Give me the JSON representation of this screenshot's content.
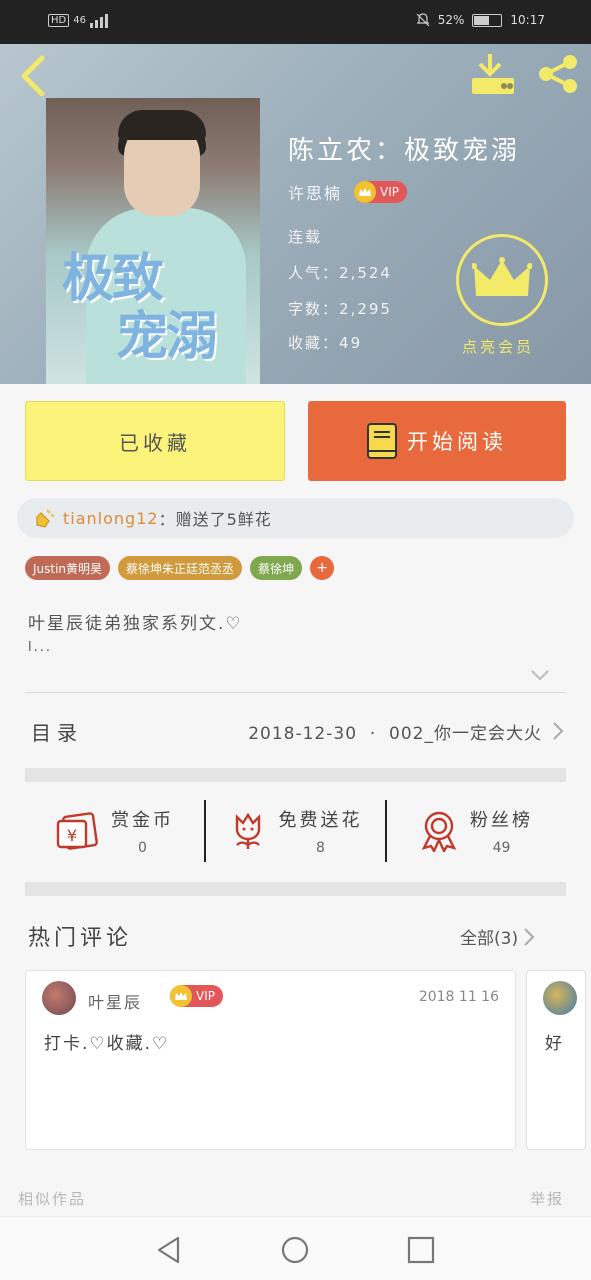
{
  "status_bar": {
    "network": "HD",
    "signal_type": "46",
    "battery_percent": "52%",
    "time": "10:17"
  },
  "book": {
    "title": "陈立农：极致宠溺",
    "author": "许思楠",
    "author_badge": "VIP",
    "status": "连载",
    "popularity_label": "人气",
    "popularity": "2,524",
    "word_count_label": "字数",
    "word_count": "2,295",
    "favorites_label": "收藏",
    "favorites": "49",
    "member_label": "点亮会员",
    "cover_text_line1": "极致",
    "cover_text_line2": "宠溺"
  },
  "actions": {
    "favorited_label": "已收藏",
    "read_label": "开始阅读"
  },
  "gift_notice": {
    "user": "tianlong12",
    "message": "：赠送了5鲜花"
  },
  "tags": [
    {
      "label": "Justin黄明昊",
      "color": "#c06a55"
    },
    {
      "label": "蔡徐坤朱正廷范丞丞",
      "color": "#d19a3c"
    },
    {
      "label": "蔡徐坤",
      "color": "#7fa84f"
    }
  ],
  "tag_more": "+",
  "description": {
    "line1": "叶星辰徒弟独家系列文.♡",
    "line2": "l..."
  },
  "catalog": {
    "label": "目录",
    "latest_date": "2018-12-30",
    "separator": "·",
    "latest_chapter": "002_你一定会大火"
  },
  "stats": [
    {
      "label": "赏金币",
      "value": "0",
      "icon": "reward-coin-icon"
    },
    {
      "label": "免费送花",
      "value": "8",
      "icon": "flower-icon"
    },
    {
      "label": "粉丝榜",
      "value": "49",
      "icon": "ribbon-medal-icon"
    }
  ],
  "comments": {
    "title": "热门评论",
    "all_label": "全部(3)",
    "items": [
      {
        "user": "叶星辰",
        "badge": "VIP",
        "date": "2018 11 16",
        "text": "打卡.♡收藏.♡"
      },
      {
        "text": "好"
      }
    ]
  },
  "footer": {
    "similar": "相似作品",
    "report": "举报"
  },
  "colors": {
    "accent_orange": "#e8693c",
    "favorited_yellow": "#fbf37a",
    "member_yellow": "#f4ea6a"
  }
}
